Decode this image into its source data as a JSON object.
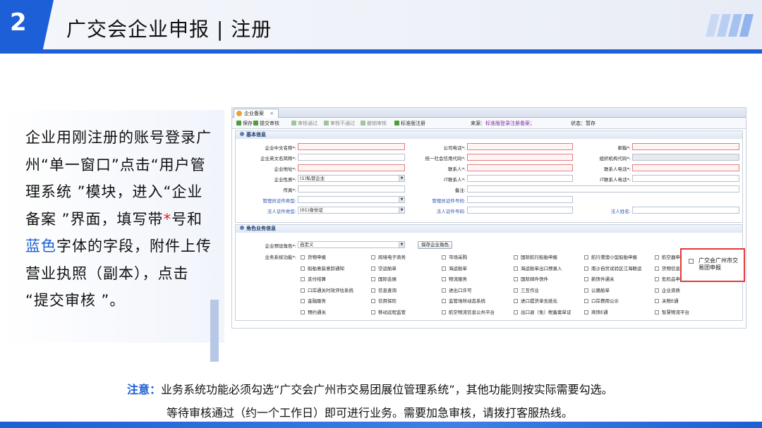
{
  "slide": {
    "number": "2",
    "title": "广交会企业申报 | 注册"
  },
  "left_text": {
    "part1": "企业用刚注册的账号登录广州“单一窗口”点击“用户管理系统 ”模块，进入“企业备案 ”界面，填写带",
    "star": "*",
    "part2": "号和",
    "blue": "蓝色",
    "part3": "字体的字段，附件上传营业执照（副本），点击 “提交审核 ”。"
  },
  "screenshot": {
    "tab_label": "企业备案",
    "tab_close": "×",
    "toolbar": {
      "save": "保存",
      "submit": "提交审核",
      "approve": "审核通过",
      "reject": "审核不通过",
      "revoke": "撤销审核",
      "std_register": "标准版注册",
      "source_label": "来源：",
      "source_value": "标准版登录注册备案；",
      "status_label": "状态：",
      "status_value": "暂存"
    },
    "basic": {
      "header": "基本信息",
      "cn_name": "企业中文名称*:",
      "en_name": "企业英文名简称*:",
      "address": "企业地址*:",
      "nature": "企业性质*:",
      "nature_value": "(1)私营企业",
      "fax": "传真*:",
      "admin_doc_type": "管理员证件类型:",
      "legal_doc_type": "法人证件类型:",
      "legal_doc_value": "(01)身份证",
      "phone": "公司电话*:",
      "credit_code": "统一社会信用代码*:",
      "contact": "联系人*:",
      "it_contact": "IT联系人*:",
      "remark": "备注:",
      "admin_doc_no": "管理员证件号码:",
      "legal_doc_no": "法人证件号码:",
      "email": "邮箱*:",
      "org_code": "组织机构代码*:",
      "contact_phone": "联系人电话*:",
      "it_contact_phone": "IT联系人电话*:",
      "legal_name": "法人姓名:"
    },
    "role": {
      "header": "角色业务信息",
      "preset_label": "企业预设角色*:",
      "preset_value": "自定义",
      "save_role": "保存企业角色",
      "functions_label": "业务系统功能*:",
      "functions": [
        [
          "货物申报",
          "跨境电子商务",
          "市场采购",
          "国际航行船舶申报",
          "航行港澳小型船舶申报",
          "航空器申"
        ],
        [
          "船舶意装意卸通知",
          "空运舱单",
          "海运舱单",
          "海运舱单出口预录入",
          "南沙自贸试验区江海联运",
          "货物信息"
        ],
        [
          "支付结算",
          "国际会展",
          "物流服务",
          "国际邮件快件",
          "新快件通关",
          "危险品申报"
        ],
        [
          "口岸通关时效评估系统",
          "信息查询",
          "进出口许可",
          "三互作业",
          "公路舱单",
          "企业资质"
        ],
        [
          "金融服务",
          "信用保险",
          "监管场所动态系统",
          "进口提货单无纸化",
          "口岸费用公示",
          "关税E通"
        ],
        [
          "预约通关",
          "移动远程监管",
          "航空物流信息公共平台",
          "出口退（免）税备案单证",
          "商快E通",
          "智慧物流平台"
        ]
      ],
      "highlight": "广交会广州市交易团申报"
    }
  },
  "note": {
    "label": "注意：",
    "line1": "业务系统功能必须勾选“广交会广州市交易团展位管理系统”，其他功能则按实际需要勾选。",
    "line2": "等待审核通过（约一个工作日）即可进行业务。需要加急审核，请拨打客服热线。"
  },
  "colors": {
    "brand": "#1c5fd6",
    "highlight_border": "#e03a3a",
    "required_field": "#e08080"
  }
}
